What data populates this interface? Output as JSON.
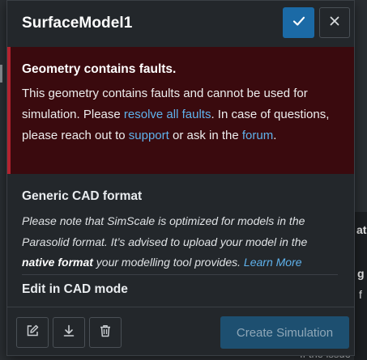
{
  "dialog": {
    "title": "SurfaceModel1",
    "confirm_icon": "check-icon",
    "close_icon": "close-icon"
  },
  "error": {
    "title": "Geometry contains faults.",
    "text_1": "This geometry contains faults and cannot be used for simulation. Please ",
    "link_resolve": "resolve all faults",
    "text_2": ". In case of questions, please reach out to ",
    "link_support": "support",
    "text_3": " or ask in the ",
    "link_forum": "forum",
    "text_4": "."
  },
  "info": {
    "title": "Generic CAD format",
    "text_1": "Please note that SimScale is optimized for models in the Parasolid format. It’s advised to upload your model in the ",
    "bold": "native format",
    "text_2": " your modelling tool provides. ",
    "link_learn": "Learn More",
    "edit_title": "Edit in CAD mode"
  },
  "footer": {
    "edit_icon": "edit-icon",
    "download_icon": "download-icon",
    "delete_icon": "trash-icon",
    "create_label": "Create Simulation"
  },
  "background": {
    "side_chars": [
      "at",
      "g",
      "f"
    ],
    "bottom_text": "If the issue"
  },
  "colors": {
    "accent": "#1b6aa6",
    "error_bg": "#3a0a0e",
    "error_border": "#b3232f",
    "link": "#5fb2ec"
  }
}
